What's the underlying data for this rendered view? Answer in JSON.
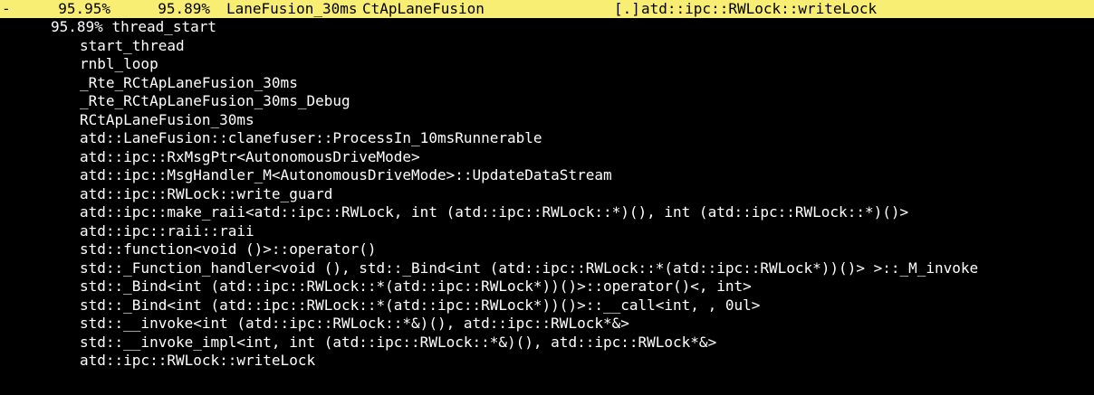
{
  "header": {
    "expander": "-",
    "children_pct": "95.95%",
    "self_pct": "95.89%",
    "command": "LaneFusion_30ms",
    "shared_object": "CtApLaneFusion",
    "symbol_type": "[.]",
    "symbol": "atd::ipc::RWLock::writeLock"
  },
  "colors": {
    "background": "#000000",
    "text": "#ffffff",
    "highlight": "#f9ee74"
  },
  "callchain": {
    "root_pct": "95.89%",
    "root_symbol": "thread_start",
    "frames": [
      "start_thread",
      "rnbl_loop",
      "_Rte_RCtApLaneFusion_30ms",
      "_Rte_RCtApLaneFusion_30ms_Debug",
      "RCtApLaneFusion_30ms",
      "atd::LaneFusion::clanefuser::ProcessIn_10msRunnerable",
      "atd::ipc::RxMsgPtr<AutonomousDriveMode>",
      "atd::ipc::MsgHandler_M<AutonomousDriveMode>::UpdateDataStream",
      "atd::ipc::RWLock::write_guard",
      "atd::ipc::make_raii<atd::ipc::RWLock, int (atd::ipc::RWLock::*)(), int (atd::ipc::RWLock::*)()>",
      "atd::ipc::raii::raii",
      "std::function<void ()>::operator()",
      "std::_Function_handler<void (), std::_Bind<int (atd::ipc::RWLock::*(atd::ipc::RWLock*))()> >::_M_invoke",
      "std::_Bind<int (atd::ipc::RWLock::*(atd::ipc::RWLock*))()>::operator()<, int>",
      "std::_Bind<int (atd::ipc::RWLock::*(atd::ipc::RWLock*))()>::__call<int, , 0ul>",
      "std::__invoke<int (atd::ipc::RWLock::*&)(), atd::ipc::RWLock*&>",
      "std::__invoke_impl<int, int (atd::ipc::RWLock::*&)(), atd::ipc::RWLock*&>",
      "atd::ipc::RWLock::writeLock"
    ]
  }
}
